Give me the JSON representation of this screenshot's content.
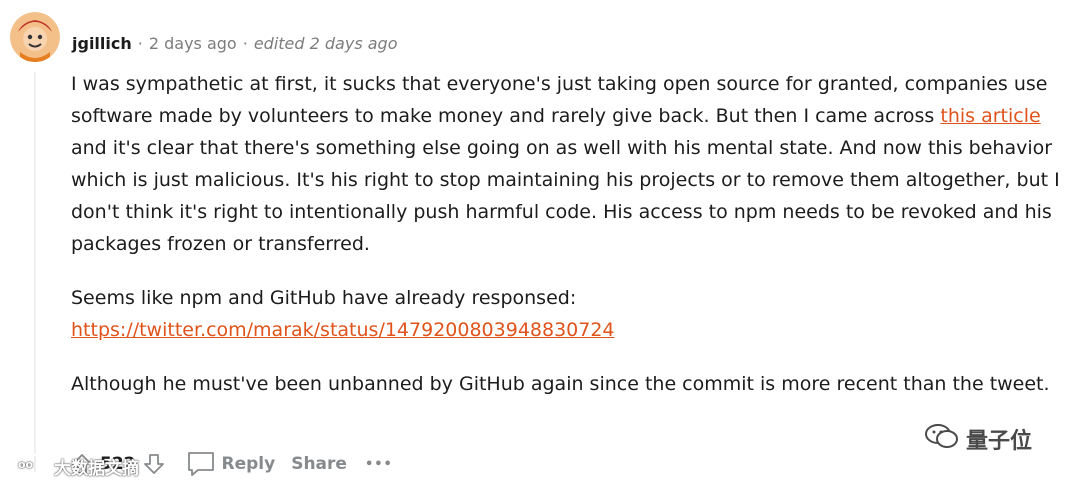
{
  "comment": {
    "username": "jgillich",
    "separator": "·",
    "posted": "2 days ago",
    "edited": "edited 2 days ago",
    "paragraphs": {
      "p1_before": "I was sympathetic at first, it sucks that everyone's just taking open source for granted, companies use software made by volunteers to make money and rarely give back. But then I came across ",
      "p1_link": "this article",
      "p1_after": " and it's clear that there's something else going on as well with his mental state. And now this behavior which is just malicious. It's his right to stop maintaining his projects or to remove them altogether, but I don't think it's right to intentionally push harmful code. His access to npm needs to be revoked and his packages frozen or transferred.",
      "p2_text": "Seems like npm and GitHub have already responsed:",
      "p2_link": "https://twitter.com/marak/status/1479200803948830724",
      "p3_text": "Although he must've been unbanned by GitHub again since the commit is more recent than the tweet."
    }
  },
  "actions": {
    "score": "522",
    "reply": "Reply",
    "share": "Share",
    "more": "•••"
  },
  "watermarks": {
    "left": "大数据文摘",
    "right": "量子位"
  },
  "colors": {
    "link": "#e0531b",
    "meta": "#7c7c7c",
    "text": "#1c1c1c"
  }
}
